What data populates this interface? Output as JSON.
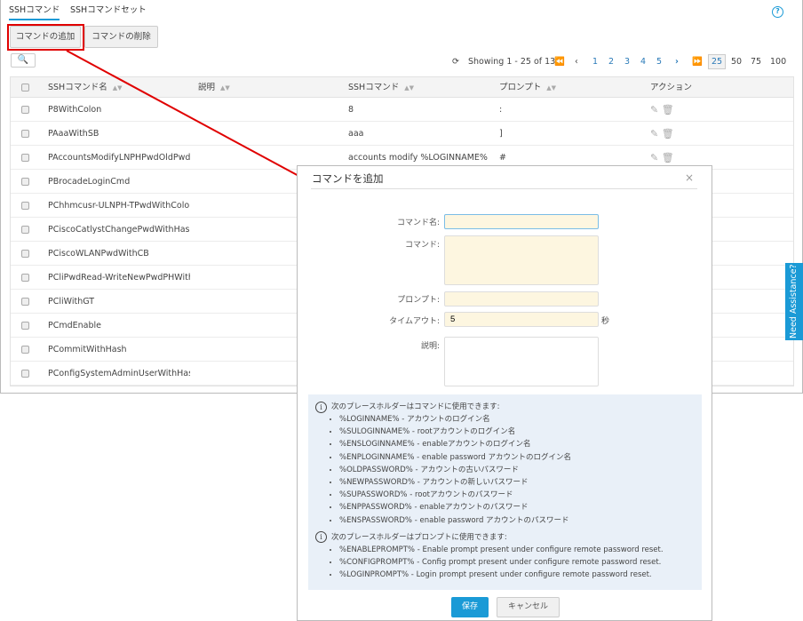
{
  "tabs": [
    {
      "label": "SSHコマンド",
      "active": true
    },
    {
      "label": "SSHコマンドセット",
      "active": false
    }
  ],
  "toolbar": {
    "add_label": "コマンドの追加",
    "delete_label": "コマンドの削除"
  },
  "help_icon": "?",
  "pager": {
    "showing": "Showing 1 - 25 of 136",
    "pages": [
      "1",
      "2",
      "3",
      "4",
      "5"
    ],
    "page_sizes": [
      "25",
      "50",
      "75",
      "100"
    ],
    "selected_size": "25"
  },
  "table": {
    "headers": [
      "SSHコマンド名",
      "説明",
      "SSHコマンド",
      "プロンプト",
      "アクション"
    ],
    "rows": [
      {
        "name": "P8WithColon",
        "desc": "",
        "cmd": "8",
        "prompt": ":"
      },
      {
        "name": "PAaaWithSB",
        "desc": "",
        "cmd": "aaa",
        "prompt": "]"
      },
      {
        "name": "PAccountsModifyLNPHPwdOldPwdNe",
        "desc": "",
        "cmd": "accounts modify %LOGINNAME% pas",
        "prompt": "#"
      },
      {
        "name": "PBrocadeLoginCmd"
      },
      {
        "name": "PChhmcusr-ULNPH-TPwdWithColon"
      },
      {
        "name": "PCiscoCatlystChangePwdWithHash"
      },
      {
        "name": "PCiscoWLANPwdWithCB"
      },
      {
        "name": "PCliPwdRead-WriteNewPwdPHWithH"
      },
      {
        "name": "PCliWithGT"
      },
      {
        "name": "PCmdEnable"
      },
      {
        "name": "PCommitWithHash"
      },
      {
        "name": "PConfigSystemAdminUserWithHash"
      }
    ]
  },
  "modal": {
    "title": "コマンドを追加",
    "close": "×",
    "labels": {
      "name": "コマンド名:",
      "command": "コマンド:",
      "prompt": "プロンプト:",
      "timeout": "タイムアウト:",
      "desc": "説明:"
    },
    "values": {
      "name": "",
      "command": "",
      "prompt": "",
      "timeout": "5",
      "desc": ""
    },
    "timeout_unit": "秒",
    "info1_title": "次のプレースホルダーはコマンドに使用できます:",
    "info1": [
      "%LOGINNAME% - アカウントのログイン名",
      "%SULOGINNAME% - rootアカウントのログイン名",
      "%ENSLOGINNAME% - enableアカウントのログイン名",
      "%ENPLOGINNAME% - enable password アカウントのログイン名",
      "%OLDPASSWORD% - アカウントの古いパスワード",
      "%NEWPASSWORD% - アカウントの新しいパスワード",
      "%SUPASSWORD% - rootアカウントのパスワード",
      "%ENPPASSWORD% - enableアカウントのパスワード",
      "%ENSPASSWORD% - enable password アカウントのパスワード"
    ],
    "info2_title": "次のプレースホルダーはプロンプトに使用できます:",
    "info2": [
      "%ENABLEPROMPT% - Enable prompt present under configure remote password reset.",
      "%CONFIGPROMPT% - Config prompt present under configure remote password reset.",
      "%LOGINPROMPT% - Login prompt present under configure remote password reset."
    ],
    "save": "保存",
    "cancel": "キャンセル"
  },
  "need_assistance": "Need Assistance?",
  "colors": {
    "accent": "#1a9ad6",
    "highlight": "#e00000"
  }
}
